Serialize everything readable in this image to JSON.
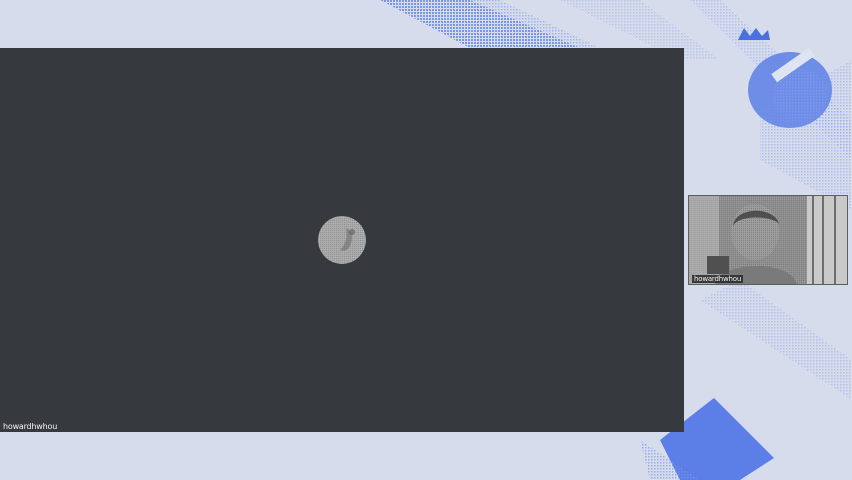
{
  "meeting": {
    "main_participant": {
      "name": "howardhwhou"
    },
    "self_view": {
      "name": "howardhwhou"
    }
  },
  "colors": {
    "background": "#d6dcec",
    "main_video_bg": "#363a3f",
    "accent_blue": "#5b7fe6"
  },
  "icons": {
    "brand_logo": "brand-logo-icon"
  }
}
